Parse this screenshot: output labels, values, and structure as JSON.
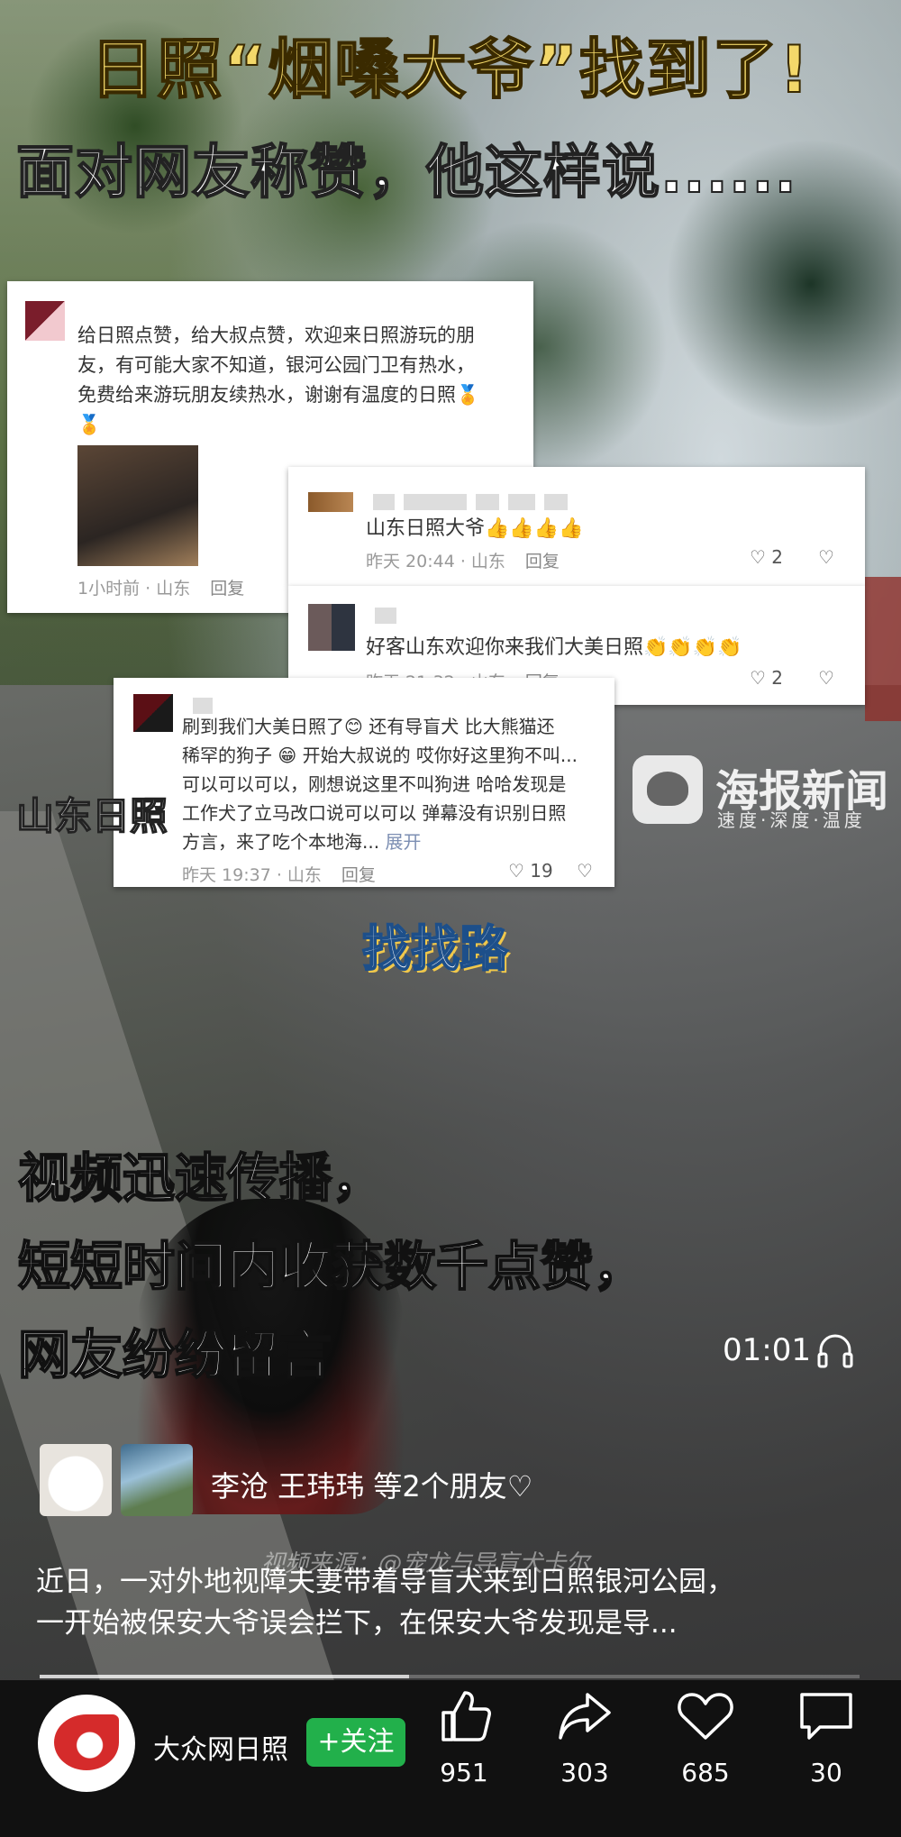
{
  "video": {
    "title_line1": "日照“烟嗓大爷”找到了!",
    "title_line2": "面对网友称赞，他这样说......",
    "location_caption": "山东日照",
    "station_logo": "海报新闻",
    "station_slogan": "速度·深度·温度",
    "bubble": "找找路",
    "subtitle_lines": [
      "视频迅速传播，",
      "短短时间内收获数千点赞，",
      "网友纷纷留言"
    ],
    "timecode": "01:01",
    "watermark": "视频来源：@宠龙与导盲犬卡尔",
    "progress_ratio": 0.45
  },
  "comments": [
    {
      "text_lines": [
        "给日照点赞，给大叔点赞，欢迎来日照游玩的朋",
        "友，有可能大家不知道，银河公园门卫有热水，",
        "免费给来游玩朋友续热水，谢谢有温度的日照🏅",
        "🏅"
      ],
      "meta": "1小时前 · 山东",
      "reply": "回复"
    },
    {
      "text": "山东日照大爷👍👍👍👍",
      "meta": "昨天 20:44 · 山东",
      "reply": "回复",
      "likes": "2"
    },
    {
      "text": "好客山东欢迎你来我们大美日照👏👏👏👏",
      "meta": "昨天 21:32 · 山东",
      "reply": "回复",
      "likes": "2"
    },
    {
      "text_lines": [
        "刷到我们大美日照了😊 还有导盲犬 比大熊猫还",
        "稀罕的狗子 😁 开始大叔说的 哎你好这里狗不叫...",
        "可以可以可以，刚想说这里不叫狗进 哈哈发现是",
        "工作犬了立马改口说可以可以 弹幕没有识别日照",
        "方言，来了吃个本地海..."
      ],
      "expand": "展开",
      "meta": "昨天 19:37 · 山东",
      "reply": "回复",
      "likes": "19"
    }
  ],
  "friends": {
    "text": "李沧 王玮玮 等2个朋友♡"
  },
  "description": {
    "lines": [
      "近日，一对外地视障夫妻带着导盲犬来到日照银河公园，",
      "一开始被保安大爷误会拦下，在保安大爷发现是导..."
    ]
  },
  "footer": {
    "channel_name": "大众网日照",
    "follow_label": "+关注",
    "actions": [
      {
        "name": "like",
        "count": "951"
      },
      {
        "name": "share",
        "count": "303"
      },
      {
        "name": "favorite",
        "count": "685"
      },
      {
        "name": "comment",
        "count": "30"
      }
    ]
  }
}
